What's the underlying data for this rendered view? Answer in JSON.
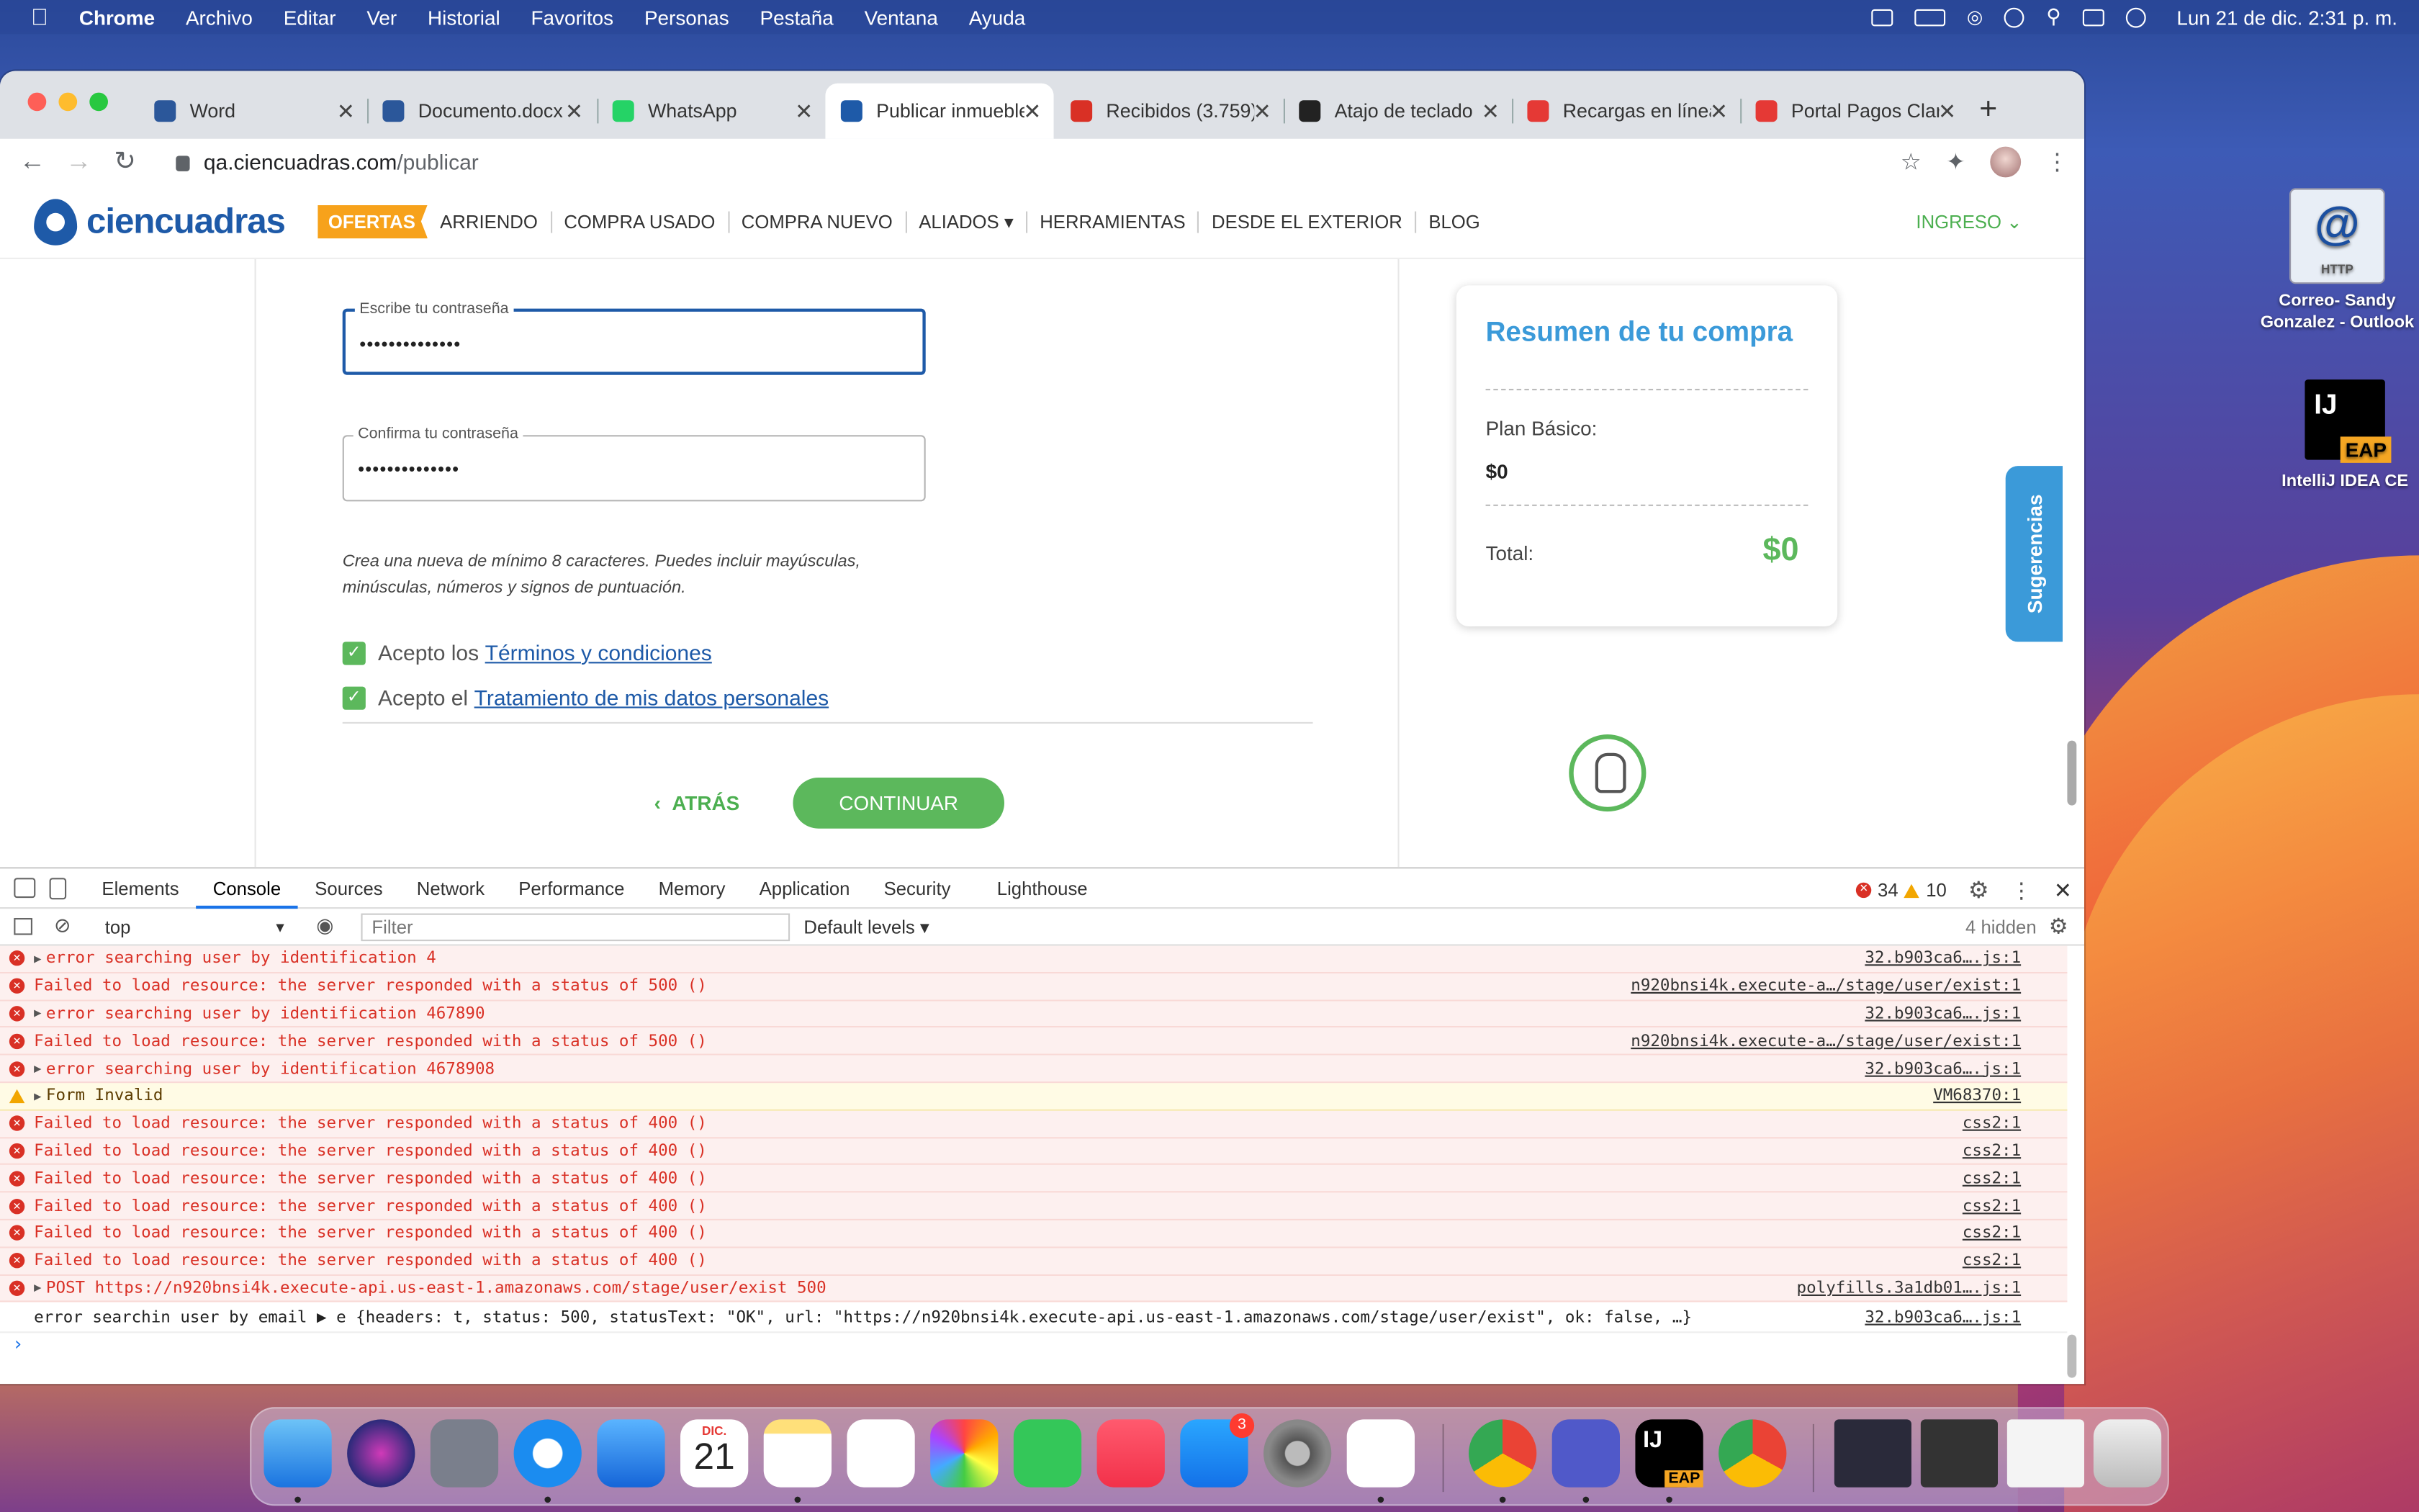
{
  "menubar": {
    "app": "Chrome",
    "items": [
      "Archivo",
      "Editar",
      "Ver",
      "Historial",
      "Favoritos",
      "Personas",
      "Pestaña",
      "Ventana",
      "Ayuda"
    ],
    "clock": "Lun 21 de dic.  2:31 p. m."
  },
  "desktop_icons": {
    "outlook": {
      "label": "Correo- Sandy Gonzalez - Outlook",
      "badge": "HTTP"
    },
    "intellij": {
      "label": "IntelliJ IDEA CE",
      "badge": "EAP",
      "mark": "IJ"
    }
  },
  "browser": {
    "tabs": [
      {
        "title": "Word",
        "icon": "word-icon",
        "color": "#2b579a"
      },
      {
        "title": "Documento.docx",
        "icon": "word-icon",
        "color": "#2b579a"
      },
      {
        "title": "WhatsApp",
        "icon": "whatsapp-icon",
        "color": "#25d366"
      },
      {
        "title": "Publicar inmueble",
        "icon": "ciencuadras-icon",
        "color": "#1e5aa8"
      },
      {
        "title": "Recibidos (3.759)",
        "icon": "gmail-icon",
        "color": "#d93025"
      },
      {
        "title": "Atajo de teclado",
        "icon": "apple-icon",
        "color": "#222222"
      },
      {
        "title": "Recargas en línea",
        "icon": "claro-icon",
        "color": "#e53935"
      },
      {
        "title": "Portal Pagos Claro",
        "icon": "claro-icon",
        "color": "#e53935"
      }
    ],
    "url_host": "qa.ciencuadras.com",
    "url_path": "/publicar"
  },
  "site": {
    "logo": "ciencuadras",
    "nav": {
      "ofertas": "OFERTAS",
      "items": [
        "ARRIENDO",
        "COMPRA USADO",
        "COMPRA NUEVO",
        "ALIADOS ▾",
        "HERRAMIENTAS",
        "DESDE EL EXTERIOR",
        "BLOG"
      ],
      "ingreso": "INGRESO ⌄"
    },
    "form": {
      "password_label": "Escribe tu contraseña",
      "password_value": "••••••••••••••",
      "confirm_label": "Confirma tu contraseña",
      "confirm_value": "••••••••••••••",
      "hint": "Crea una nueva de mínimo 8 caracteres. Puedes incluir mayúsculas, minúsculas, números y signos de puntuación.",
      "terms_prefix": "Acepto los",
      "terms_link": "Términos y condiciones",
      "data_prefix": "Acepto el",
      "data_link": "Tratamiento de mis datos personales",
      "back": "ATRÁS",
      "continue": "CONTINUAR"
    },
    "summary": {
      "title": "Resumen de tu compra",
      "plan_label": "Plan Básico:",
      "plan_value": "$0",
      "total_label": "Total:",
      "total_value": "$0"
    },
    "sugerencias": "Sugerencias"
  },
  "devtools": {
    "tabs": [
      "Elements",
      "Console",
      "Sources",
      "Network",
      "Performance",
      "Memory",
      "Application",
      "Security",
      "Lighthouse"
    ],
    "active_tab": "Console",
    "errors": "34",
    "warnings": "10",
    "context": "top",
    "filter_placeholder": "Filter",
    "levels": "Default levels ▾",
    "hidden": "4 hidden",
    "logs": [
      {
        "type": "err",
        "expand": true,
        "msg": "error searching user by identification 4",
        "src": "32.b903ca6….js:1"
      },
      {
        "type": "err",
        "expand": false,
        "msg": "Failed to load resource: the server responded with a status of 500 ()",
        "src": "n920bnsi4k.execute-a…/stage/user/exist:1"
      },
      {
        "type": "err",
        "expand": true,
        "msg": "error searching user by identification 467890",
        "src": "32.b903ca6….js:1"
      },
      {
        "type": "err",
        "expand": false,
        "msg": "Failed to load resource: the server responded with a status of 500 ()",
        "src": "n920bnsi4k.execute-a…/stage/user/exist:1"
      },
      {
        "type": "err",
        "expand": true,
        "msg": "error searching user by identification 4678908",
        "src": "32.b903ca6….js:1"
      },
      {
        "type": "warn",
        "expand": true,
        "msg": "Form Invalid",
        "src": "VM68370:1"
      },
      {
        "type": "err",
        "expand": false,
        "msg": "Failed to load resource: the server responded with a status of 400 ()",
        "src": "css2:1"
      },
      {
        "type": "err",
        "expand": false,
        "msg": "Failed to load resource: the server responded with a status of 400 ()",
        "src": "css2:1"
      },
      {
        "type": "err",
        "expand": false,
        "msg": "Failed to load resource: the server responded with a status of 400 ()",
        "src": "css2:1"
      },
      {
        "type": "err",
        "expand": false,
        "msg": "Failed to load resource: the server responded with a status of 400 ()",
        "src": "css2:1"
      },
      {
        "type": "err",
        "expand": false,
        "msg": "Failed to load resource: the server responded with a status of 400 ()",
        "src": "css2:1"
      },
      {
        "type": "err",
        "expand": false,
        "msg": "Failed to load resource: the server responded with a status of 400 ()",
        "src": "css2:1"
      },
      {
        "type": "err",
        "expand": true,
        "msg": "POST https://n920bnsi4k.execute-api.us-east-1.amazonaws.com/stage/user/exist 500",
        "src": "polyfills.3a1db01….js:1"
      },
      {
        "type": "plain",
        "expand": false,
        "msg": "error searchin user by email  ▶ e {headers: t, status: 500, statusText: \"OK\", url: \"https://n920bnsi4k.execute-api.us-east-1.amazonaws.com/stage/user/exist\", ok: false, …}",
        "src": "32.b903ca6….js:1"
      }
    ]
  },
  "dock": {
    "calendar_month": "DIC.",
    "calendar_day": "21",
    "appstore_badge": "3",
    "intellij_badge": "EAP"
  }
}
